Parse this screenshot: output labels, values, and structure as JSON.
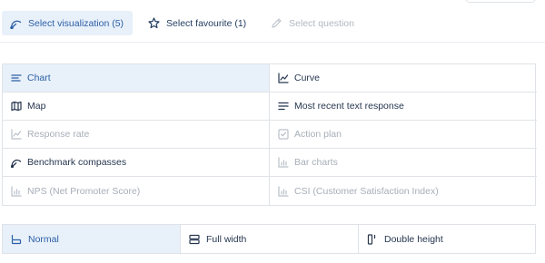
{
  "colors": {
    "accent": "#2b5fa5",
    "selected_bg": "#e8f0fa",
    "border": "#dfe3e8",
    "text": "#26364f",
    "disabled_text": "#a7aeb8"
  },
  "tabs": [
    {
      "label": "Select visualization (5)",
      "icon": "compass-icon",
      "state": "active"
    },
    {
      "label": "Select favourite (1)",
      "icon": "star-icon",
      "state": "normal"
    },
    {
      "label": "Select question",
      "icon": "pencil-icon",
      "state": "disabled"
    }
  ],
  "visualizations": [
    {
      "label": "Chart",
      "icon": "bar-lines-icon",
      "state": "selected"
    },
    {
      "label": "Curve",
      "icon": "line-chart-icon",
      "state": "enabled"
    },
    {
      "label": "Map",
      "icon": "map-icon",
      "state": "enabled"
    },
    {
      "label": "Most recent text response",
      "icon": "text-lines-icon",
      "state": "enabled"
    },
    {
      "label": "Response rate",
      "icon": "line-chart-icon",
      "state": "disabled"
    },
    {
      "label": "Action plan",
      "icon": "checkbox-icon",
      "state": "disabled"
    },
    {
      "label": "Benchmark compasses",
      "icon": "compass-icon",
      "state": "enabled"
    },
    {
      "label": "Bar charts",
      "icon": "bar-chart-icon",
      "state": "disabled"
    },
    {
      "label": "NPS (Net Promoter Score)",
      "icon": "bar-chart-icon",
      "state": "disabled"
    },
    {
      "label": "CSI (Customer Satisfaction Index)",
      "icon": "bar-chart-icon",
      "state": "disabled"
    }
  ],
  "layout_options": [
    {
      "label": "Normal",
      "icon": "layout-normal-icon",
      "state": "selected"
    },
    {
      "label": "Full width",
      "icon": "layout-full-width-icon",
      "state": "enabled"
    },
    {
      "label": "Double height",
      "icon": "layout-double-height-icon",
      "state": "enabled"
    }
  ]
}
